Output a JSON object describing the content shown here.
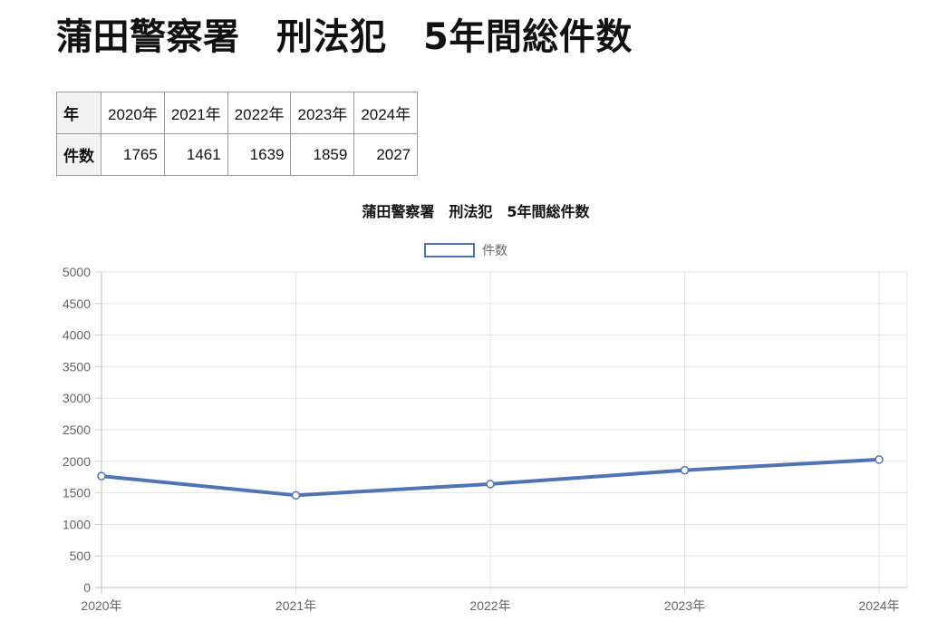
{
  "page": {
    "title": "蒲田警察署　刑法犯　5年間総件数"
  },
  "table": {
    "row_header_year": "年",
    "row_header_count": "件数",
    "years": [
      "2020年",
      "2021年",
      "2022年",
      "2023年",
      "2024年"
    ],
    "counts": [
      "1765",
      "1461",
      "1639",
      "1859",
      "2027"
    ]
  },
  "chart_data": {
    "type": "line",
    "title": "蒲田警察署　刑法犯　5年間総件数",
    "categories": [
      "2020年",
      "2021年",
      "2022年",
      "2023年",
      "2024年"
    ],
    "series": [
      {
        "name": "件数",
        "values": [
          1765,
          1461,
          1639,
          1859,
          2027
        ],
        "color": "#4f74b3"
      }
    ],
    "ylim": [
      0,
      5000
    ],
    "yticks": [
      "0",
      "500",
      "1000",
      "1500",
      "2000",
      "2500",
      "3000",
      "3500",
      "4000",
      "4500",
      "5000"
    ],
    "grid": true,
    "legend": "top-center"
  }
}
